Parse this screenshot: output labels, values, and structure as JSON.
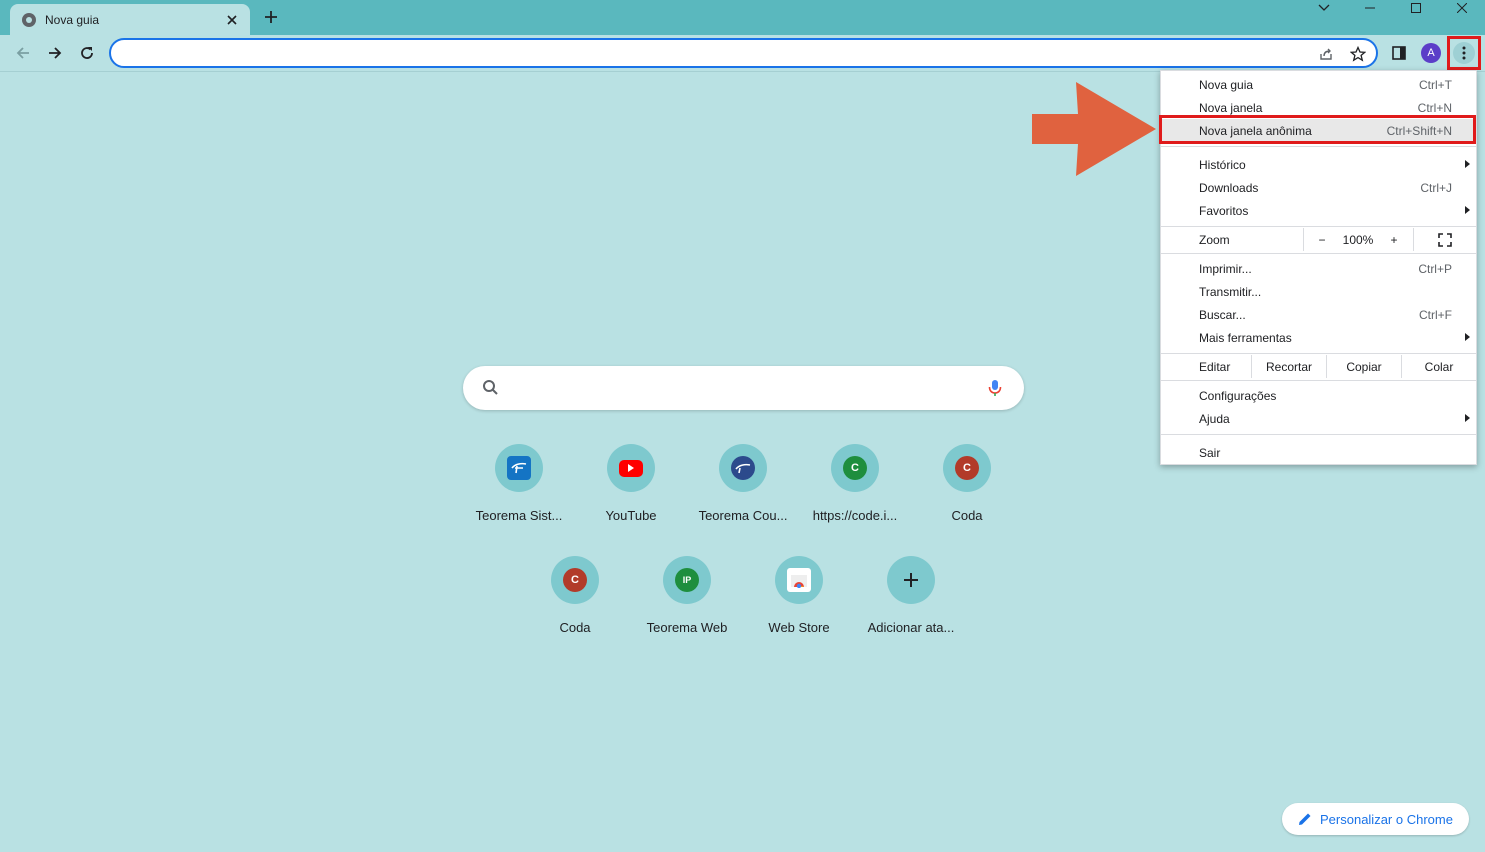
{
  "tab": {
    "title": "Nova guia"
  },
  "omnibox": {
    "value": ""
  },
  "search": {
    "placeholder": ""
  },
  "shortcuts": [
    {
      "label": "Teorema Sist...",
      "icon": "teorema-icon"
    },
    {
      "label": "YouTube",
      "icon": "youtube-icon"
    },
    {
      "label": "Teorema Cou...",
      "icon": "teorema-courses-icon"
    },
    {
      "label": "https://code.i...",
      "letter": "C",
      "color": "#1e8e3e"
    },
    {
      "label": "Coda",
      "letter": "C",
      "color": "#b23b2a"
    },
    {
      "label": "Coda",
      "letter": "C",
      "color": "#b23b2a"
    },
    {
      "label": "Teorema Web",
      "letter": "IP",
      "color": "#1e8e3e"
    },
    {
      "label": "Web Store",
      "icon": "webstore-icon"
    },
    {
      "label": "Adicionar ata...",
      "icon": "plus-icon"
    }
  ],
  "profile": {
    "initial": "A"
  },
  "customize": {
    "label": "Personalizar o Chrome"
  },
  "menu": {
    "new_tab": {
      "label": "Nova guia",
      "shortcut": "Ctrl+T"
    },
    "new_window": {
      "label": "Nova janela",
      "shortcut": "Ctrl+N"
    },
    "incognito": {
      "label": "Nova janela anônima",
      "shortcut": "Ctrl+Shift+N"
    },
    "history": {
      "label": "Histórico"
    },
    "downloads": {
      "label": "Downloads",
      "shortcut": "Ctrl+J"
    },
    "bookmarks": {
      "label": "Favoritos"
    },
    "zoom": {
      "label": "Zoom",
      "minus": "−",
      "value": "100%",
      "plus": "+"
    },
    "print": {
      "label": "Imprimir...",
      "shortcut": "Ctrl+P"
    },
    "cast": {
      "label": "Transmitir..."
    },
    "find": {
      "label": "Buscar...",
      "shortcut": "Ctrl+F"
    },
    "more_tools": {
      "label": "Mais ferramentas"
    },
    "edit": {
      "label": "Editar",
      "cut": "Recortar",
      "copy": "Copiar",
      "paste": "Colar"
    },
    "settings": {
      "label": "Configurações"
    },
    "help": {
      "label": "Ajuda"
    },
    "exit": {
      "label": "Sair"
    }
  },
  "colors": {
    "accent": "#1a73e8",
    "highlight": "#e01b1b",
    "arrow": "#e0623f",
    "frame": "#5ab8be",
    "background": "#b9e1e3"
  }
}
